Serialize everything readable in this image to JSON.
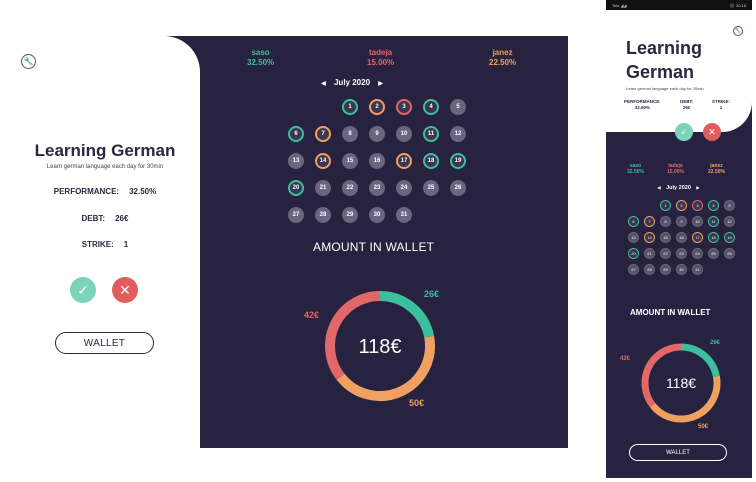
{
  "app": {
    "title": "Learning German",
    "subtitle": "Learn german language each day for 30min",
    "performance_label": "PERFORMANCE:",
    "performance_value": "32.50%",
    "debt_label": "DEBT:",
    "debt_value": "26€",
    "strike_label": "STRIKE:",
    "strike_value": "1",
    "wallet_button": "WALLET",
    "confirm_icon": "✓",
    "reject_icon": "✕",
    "settings_icon": "wrench-icon"
  },
  "users": [
    {
      "name": "saso",
      "percent": "32.50%",
      "color": "#3dbf9e"
    },
    {
      "name": "tadeja",
      "percent": "15.00%",
      "color": "#e06868"
    },
    {
      "name": "janez",
      "percent": "22.50%",
      "color": "#f0a060"
    }
  ],
  "calendar": {
    "month": "July 2020",
    "prev": "◀",
    "next": "▶",
    "days": [
      {
        "n": "1",
        "s": "g"
      },
      {
        "n": "2",
        "s": "o"
      },
      {
        "n": "3",
        "s": "r"
      },
      {
        "n": "4",
        "s": "g"
      },
      {
        "n": "5",
        "s": ""
      },
      {
        "n": "6",
        "s": "g"
      },
      {
        "n": "7",
        "s": "o"
      },
      {
        "n": "8",
        "s": ""
      },
      {
        "n": "9",
        "s": ""
      },
      {
        "n": "10",
        "s": ""
      },
      {
        "n": "11",
        "s": "g"
      },
      {
        "n": "12",
        "s": ""
      },
      {
        "n": "13",
        "s": ""
      },
      {
        "n": "14",
        "s": "o"
      },
      {
        "n": "15",
        "s": ""
      },
      {
        "n": "16",
        "s": ""
      },
      {
        "n": "17",
        "s": "o"
      },
      {
        "n": "18",
        "s": "g"
      },
      {
        "n": "19",
        "s": "g"
      },
      {
        "n": "20",
        "s": "g"
      },
      {
        "n": "21",
        "s": ""
      },
      {
        "n": "22",
        "s": ""
      },
      {
        "n": "23",
        "s": ""
      },
      {
        "n": "24",
        "s": ""
      },
      {
        "n": "25",
        "s": ""
      },
      {
        "n": "26",
        "s": ""
      },
      {
        "n": "27",
        "s": ""
      },
      {
        "n": "28",
        "s": ""
      },
      {
        "n": "29",
        "s": ""
      },
      {
        "n": "30",
        "s": ""
      },
      {
        "n": "31",
        "s": ""
      }
    ]
  },
  "wallet": {
    "title": "AMOUNT IN WALLET",
    "total": "118€",
    "segments": [
      {
        "label": "26€",
        "value": 26,
        "color": "#3dbf9e"
      },
      {
        "label": "50€",
        "value": 50,
        "color": "#f0a060"
      },
      {
        "label": "42€",
        "value": 42,
        "color": "#e06868"
      }
    ]
  },
  "phone_status": {
    "left": "Tele ◢◢",
    "right": "⚫ 20:18"
  }
}
